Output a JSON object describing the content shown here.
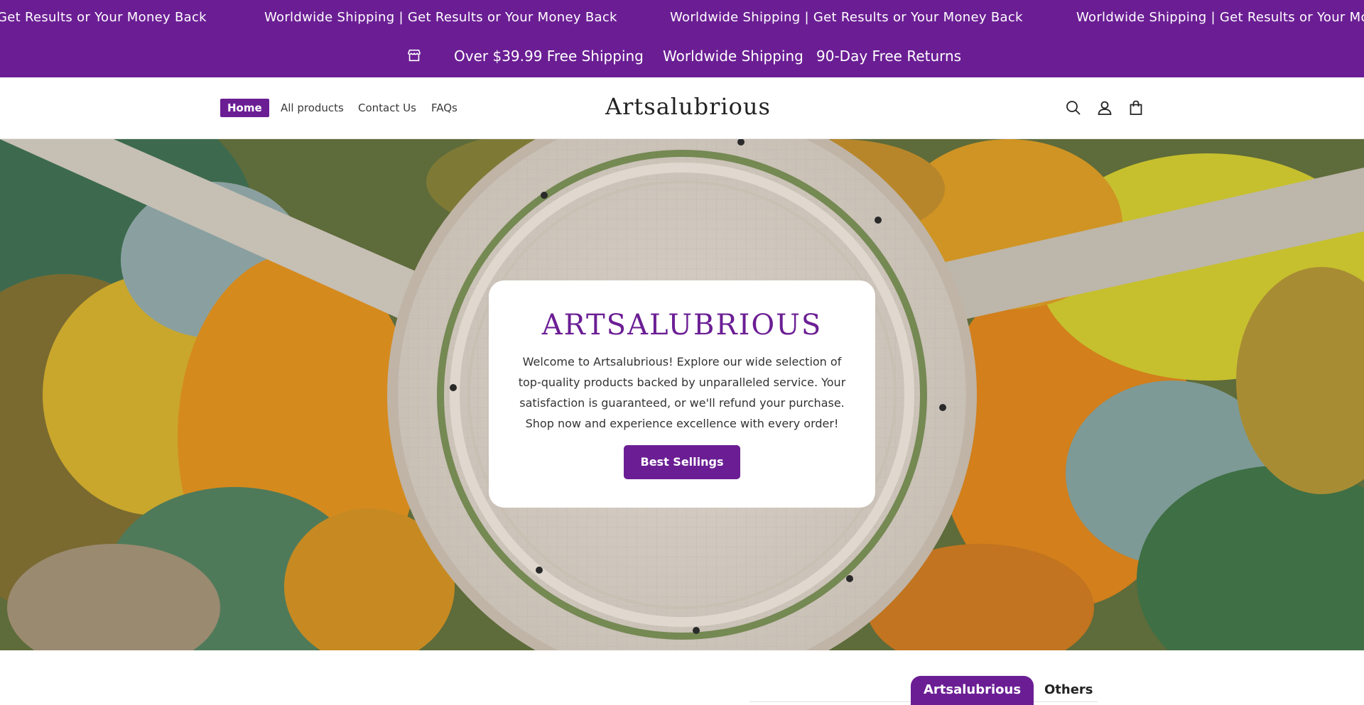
{
  "marquee": {
    "items": [
      "Get Results or Your Money Back",
      "Worldwide Shipping | Get Results or Your Money Back",
      "Worldwide Shipping | Get Results or Your Money Back",
      "Worldwide Shipping | Get Results or Your Money Back"
    ]
  },
  "perks": {
    "icon": "store-icon",
    "items": [
      "Over $39.99 Free Shipping",
      "Worldwide Shipping",
      "90-Day Free Returns"
    ]
  },
  "nav": {
    "items": [
      {
        "label": "Home",
        "active": true
      },
      {
        "label": "All products"
      },
      {
        "label": "Contact Us"
      },
      {
        "label": "FAQs"
      }
    ]
  },
  "brand": {
    "logo": "Artsalubrious"
  },
  "header_icons": [
    "search-icon",
    "account-icon",
    "cart-icon"
  ],
  "hero": {
    "title": "ARTSALUBRIOUS",
    "text": "Welcome to Artsalubrious! Explore our wide selection of top-quality products backed by unparalleled service. Your satisfaction is guaranteed, or we'll refund your purchase. Shop now and experience excellence with every order!",
    "button": "Best Sellings"
  },
  "tabs": [
    {
      "label": "Artsalubrious",
      "active": true
    },
    {
      "label": "Others"
    }
  ],
  "colors": {
    "brand": "#6b1e94",
    "white": "#ffffff"
  }
}
